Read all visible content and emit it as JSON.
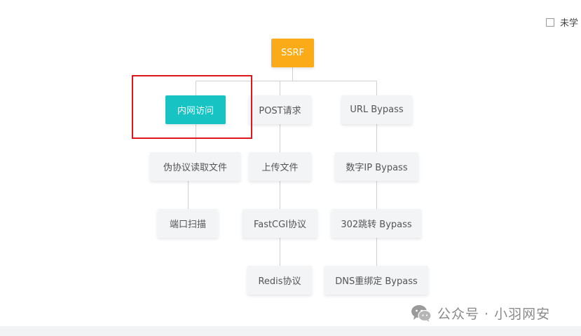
{
  "legend": {
    "label": "未学"
  },
  "nodes": {
    "root": "SSRF",
    "intranet": "内网访问",
    "post": "POST请求",
    "url_bypass": "URL Bypass",
    "pseudo_protocol": "伪协议读取文件",
    "upload": "上传文件",
    "numeric_ip": "数字IP Bypass",
    "port_scan": "端口扫描",
    "fastcgi": "FastCGI协议",
    "redirect_302": "302跳转 Bypass",
    "redis": "Redis协议",
    "dns_rebind": "DNS重绑定 Bypass"
  },
  "watermark": {
    "text": "公众号 · 小羽网安"
  },
  "colors": {
    "root": "#fbab18",
    "active": "#17c3c3",
    "node": "#f3f4f6",
    "highlight": "#e0161b",
    "connector": "#d0d0d0"
  }
}
